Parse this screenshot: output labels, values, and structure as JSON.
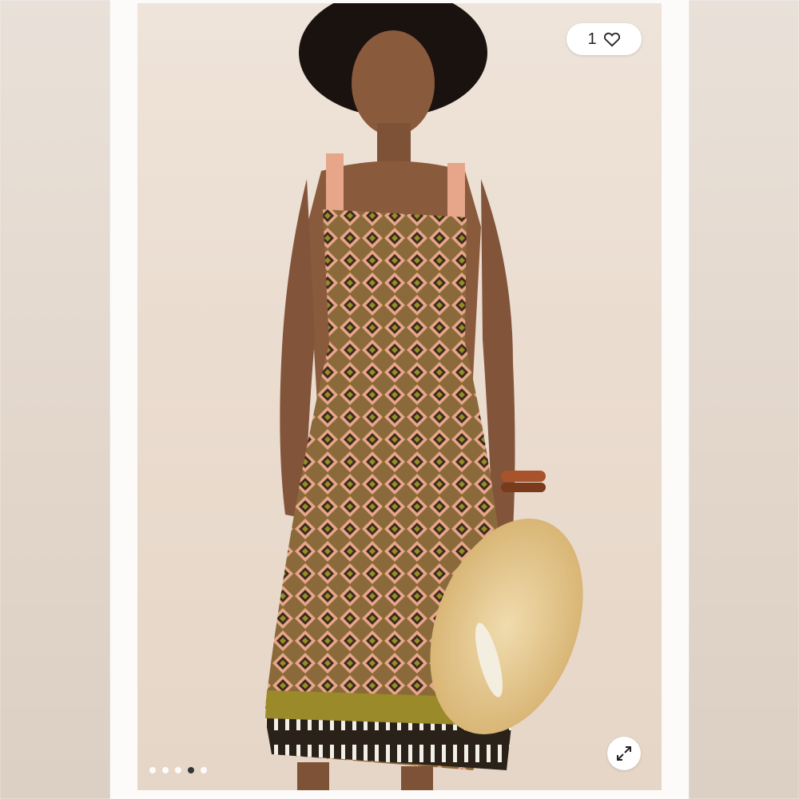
{
  "product_image": {
    "alt": "",
    "like": {
      "count": "1",
      "icon": "heart-outline-icon"
    },
    "expand": {
      "icon": "expand-arrows-icon"
    },
    "carousel": {
      "total": 5,
      "active_index": 3
    }
  },
  "colors": {
    "backdrop": "#eadccf",
    "dress_base": "#8a6a3a",
    "dress_accent": "#e7a58a",
    "dress_dark": "#3a2c1c",
    "hat": "#e6c88c",
    "skin": "#8a5a3c",
    "hair": "#1a120e"
  }
}
